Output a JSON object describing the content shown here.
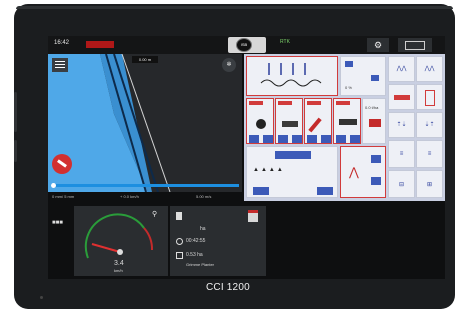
{
  "status": {
    "time": "16:42",
    "round_badge": "ISB",
    "signal": "RTK"
  },
  "map": {
    "scale_label": "0.00 m",
    "info_left": "0 mm/ 5 mm",
    "info_mid": "+ 0.0 km/h",
    "info_right": "5.00 m/s"
  },
  "panel": {
    "tile_lbl_1": "0.0 t/ha",
    "tile_lbl_2": "0 %",
    "tile_lbl_3": "0 l/h"
  },
  "bottom": {
    "speed_value": "3.4",
    "speed_unit": "km/h",
    "work_label": "ha",
    "time_value": "00:42:55",
    "area_value": "0.53 ha",
    "area_label": "Grimme Planter"
  },
  "brand": {
    "name": "CCI 1200"
  },
  "colors": {
    "screen_bg": "#0e0f10",
    "map_field": "#4fa8e8",
    "accent_red": "#b01818",
    "panel_bg": "#c9cfe2"
  }
}
